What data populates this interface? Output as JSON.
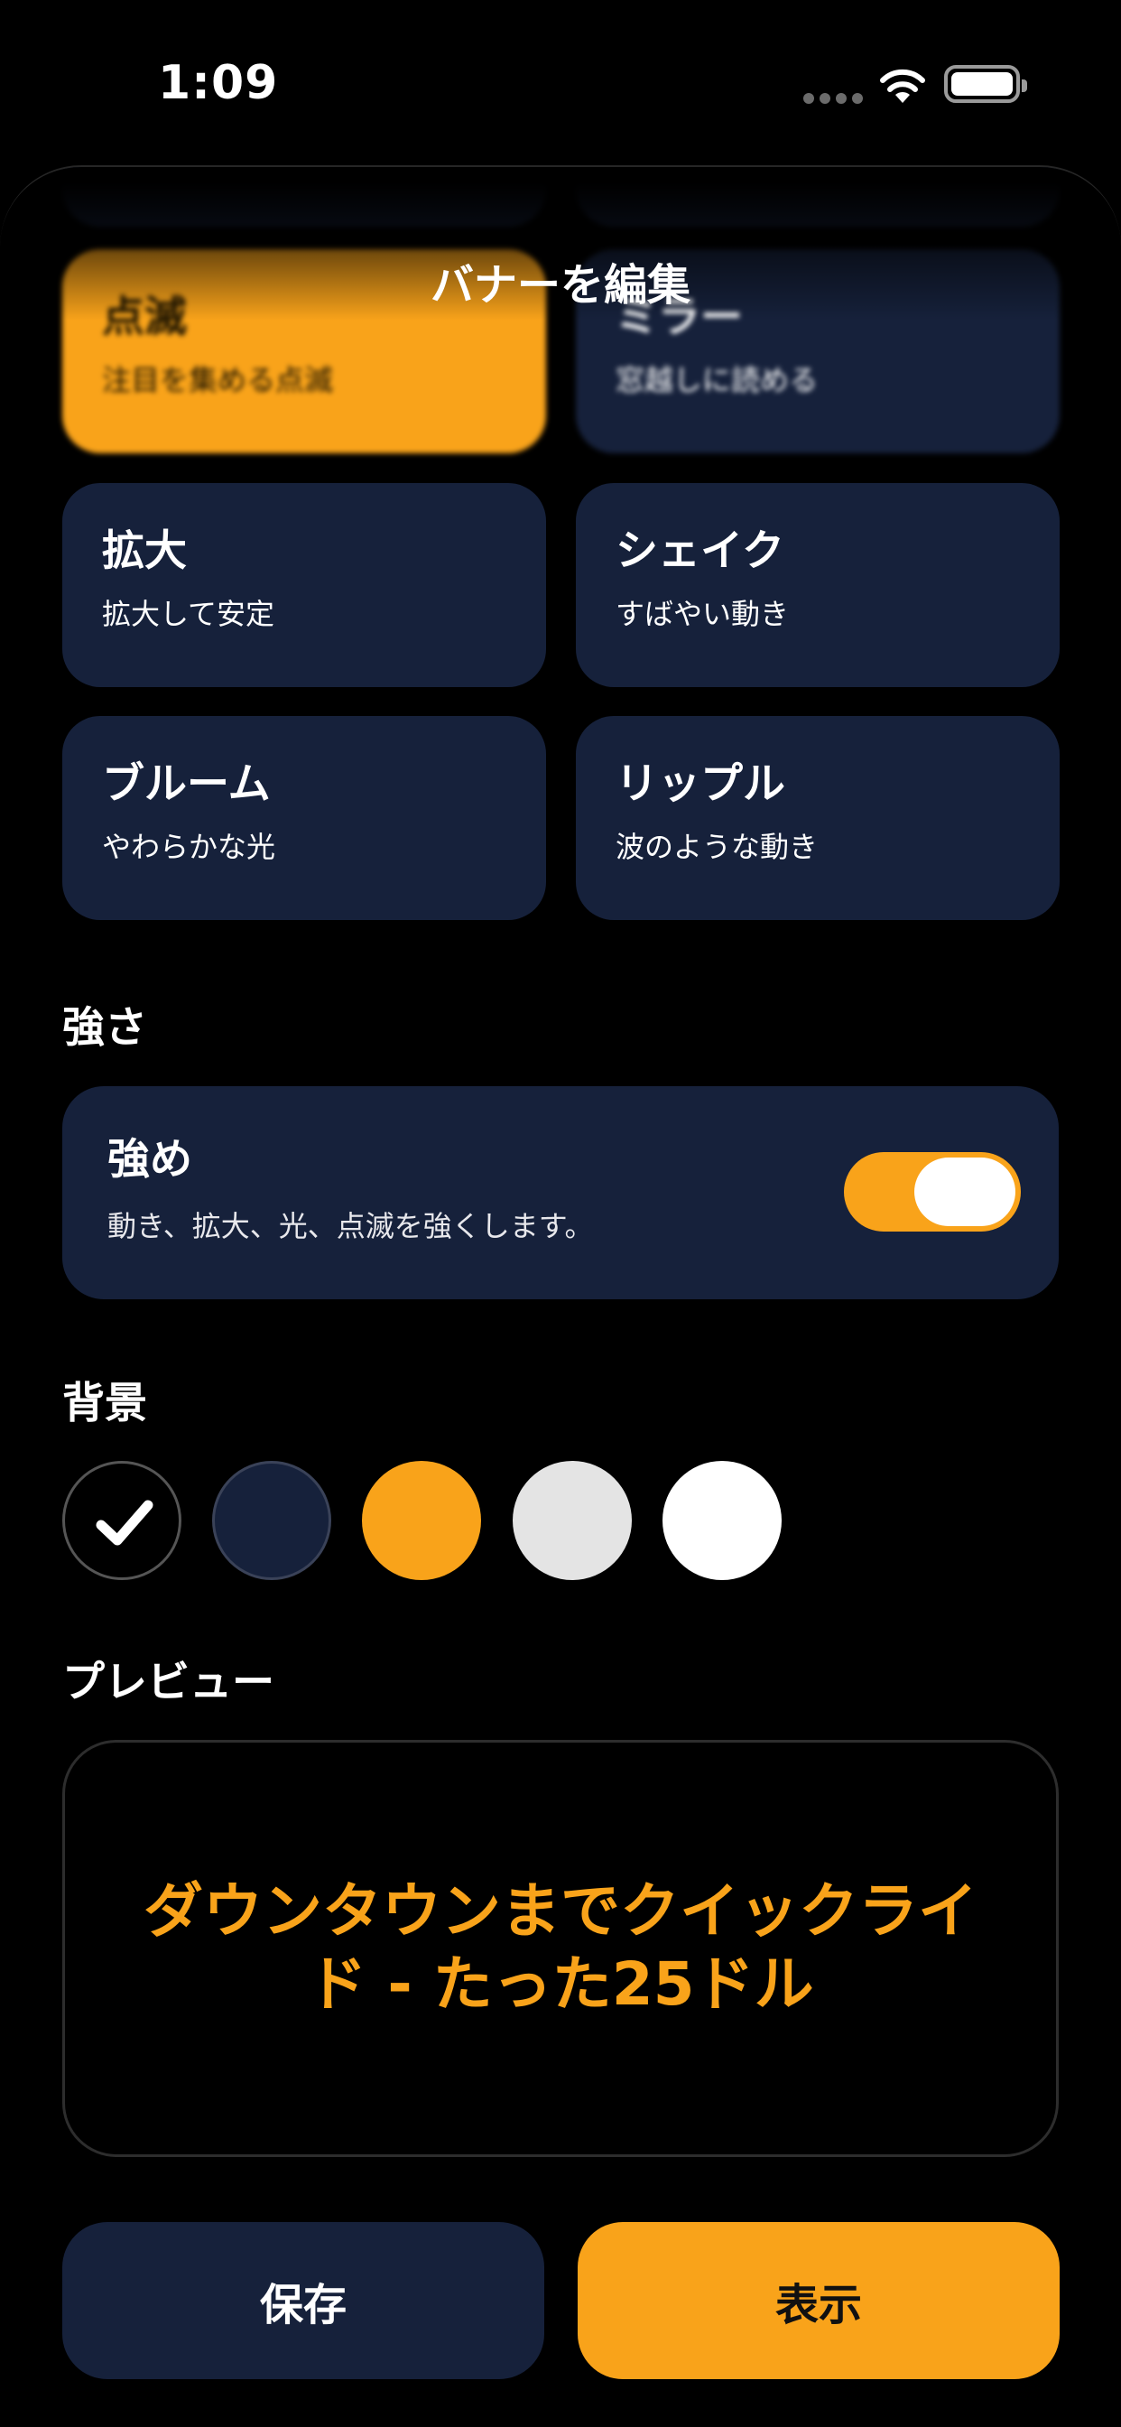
{
  "status_bar": {
    "time": "1:09"
  },
  "sheet": {
    "title": "バナーを編集"
  },
  "effects": [
    {
      "title": "点滅",
      "subtitle": "注目を集める点滅",
      "selected": true
    },
    {
      "title": "ミラー",
      "subtitle": "窓越しに読める",
      "selected": false
    },
    {
      "title": "拡大",
      "subtitle": "拡大して安定",
      "selected": false
    },
    {
      "title": "シェイク",
      "subtitle": "すばやい動き",
      "selected": false
    },
    {
      "title": "ブルーム",
      "subtitle": "やわらかな光",
      "selected": false
    },
    {
      "title": "リップル",
      "subtitle": "波のような動き",
      "selected": false
    }
  ],
  "intensity": {
    "section_label": "強さ",
    "title": "強め",
    "subtitle": "動き、拡大、光、点滅を強くします。",
    "toggle_on": true
  },
  "background": {
    "section_label": "背景",
    "swatches": [
      {
        "color": "#000000",
        "selected": true
      },
      {
        "color": "#16213b",
        "selected": false
      },
      {
        "color": "#f9a31a",
        "selected": false
      },
      {
        "color": "#e4e4e4",
        "selected": false
      },
      {
        "color": "#ffffff",
        "selected": false
      }
    ]
  },
  "preview": {
    "section_label": "プレビュー",
    "text": "ダウンタウンまでクイックライド - たった25ドル",
    "text_color": "#f9a31a"
  },
  "actions": {
    "save_label": "保存",
    "show_label": "表示"
  },
  "colors": {
    "accent": "#f9a31a",
    "card": "#16213b",
    "background": "#000000"
  }
}
